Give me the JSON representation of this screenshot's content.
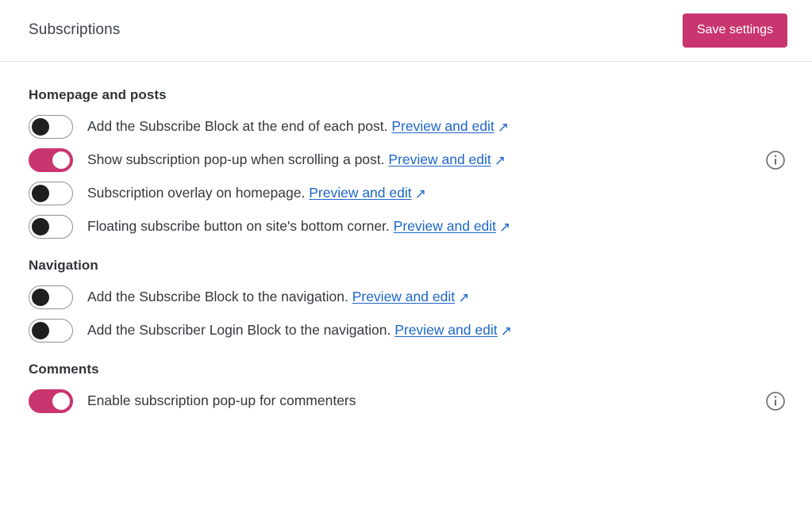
{
  "header": {
    "title": "Subscriptions",
    "save_label": "Save settings",
    "accent_color": "#c9356e"
  },
  "link_common": {
    "label": "Preview and edit",
    "icon": "external-link-arrow-icon",
    "glyph": "↗",
    "color": "#1d66c9"
  },
  "sections": [
    {
      "id": "homepage-and-posts",
      "heading": "Homepage and posts",
      "rows": [
        {
          "id": "subscribe-block-end-of-post",
          "label": "Add the Subscribe Block at the end of each post.",
          "toggle": "off",
          "link": "Preview and edit",
          "info": false
        },
        {
          "id": "subscription-popup-scrolling",
          "label": "Show subscription pop-up when scrolling a post.",
          "toggle": "on",
          "link": "Preview and edit",
          "info": true
        },
        {
          "id": "subscription-overlay-homepage",
          "label": "Subscription overlay on homepage.",
          "toggle": "off",
          "link": "Preview and edit",
          "info": false
        },
        {
          "id": "floating-subscribe-button",
          "label": "Floating subscribe button on site's bottom corner.",
          "toggle": "off",
          "link": "Preview and edit",
          "info": false
        }
      ]
    },
    {
      "id": "navigation",
      "heading": "Navigation",
      "rows": [
        {
          "id": "subscribe-block-navigation",
          "label": "Add the Subscribe Block to the navigation.",
          "toggle": "off",
          "link": "Preview and edit",
          "info": false
        },
        {
          "id": "subscriber-login-block-navigation",
          "label": "Add the Subscriber Login Block to the navigation.",
          "toggle": "off",
          "link": "Preview and edit",
          "info": false
        }
      ]
    },
    {
      "id": "comments",
      "heading": "Comments",
      "rows": [
        {
          "id": "subscription-popup-commenters",
          "label": "Enable subscription pop-up for commenters",
          "toggle": "on",
          "link": "",
          "info": true
        }
      ]
    }
  ]
}
